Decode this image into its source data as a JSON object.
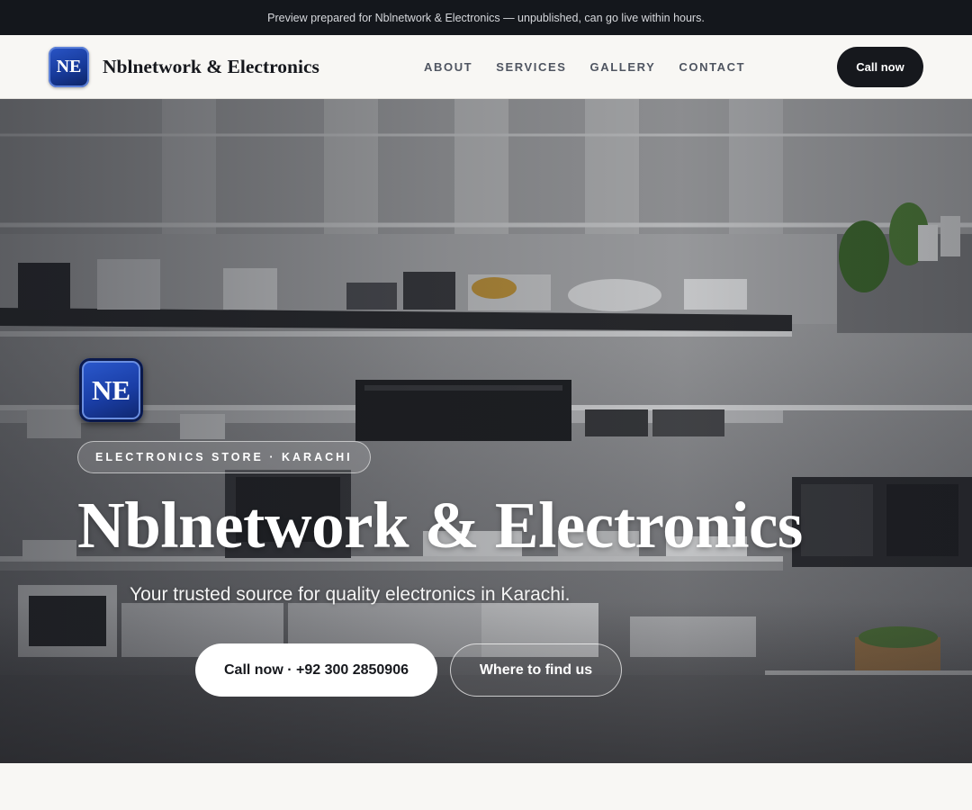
{
  "preview_banner": {
    "text": "Preview prepared for Nblnetwork & Electronics — unpublished, can go live within hours."
  },
  "nav": {
    "logo_initials": "NE",
    "brand_name": "Nblnetwork & Electronics",
    "links": [
      "ABOUT",
      "SERVICES",
      "GALLERY",
      "CONTACT"
    ],
    "cta_label": "Call now"
  },
  "hero": {
    "logo_initials": "NE",
    "tag": "ELECTRONICS STORE · KARACHI",
    "title": "Nblnetwork & Electronics",
    "subtitle": "Your trusted source for quality electronics in Karachi.",
    "primary_button": "Call now · +92 300 2850906",
    "secondary_button": "Where to find us"
  },
  "colors": {
    "dark": "#14171c",
    "brand_blue": "#1a3ea6",
    "page_bg": "#f7f6f3"
  }
}
